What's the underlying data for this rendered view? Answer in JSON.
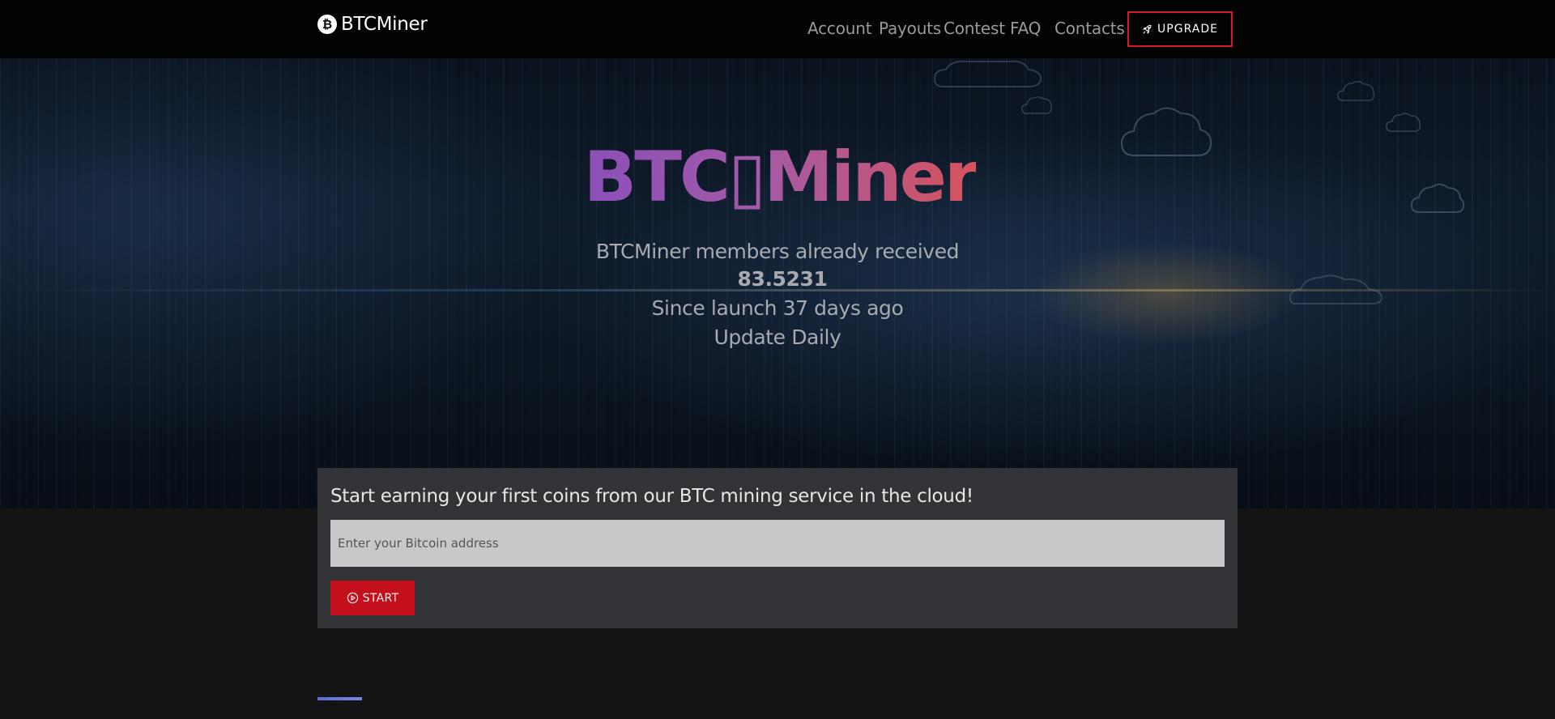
{
  "navbar": {
    "brand_icon": "bitcoin-icon",
    "brand_name": "BTCMiner",
    "links": [
      {
        "label": "Account"
      },
      {
        "label": "Payouts"
      },
      {
        "label": "Contest"
      },
      {
        "label": "FAQ"
      },
      {
        "label": "Contacts"
      }
    ],
    "upgrade": {
      "icon": "rocket-icon",
      "label": "UPGRADE",
      "border_color": "#d8192b"
    }
  },
  "hero": {
    "logo_text": "BTC▯Miner",
    "received_text": "BTCMiner members already received",
    "received_amount": "83.5231",
    "launch_text": "Since launch 37 days ago",
    "update_text": "Update Daily",
    "logo_gradient": [
      "#8b4fb8",
      "#d5535c"
    ]
  },
  "signup": {
    "heading": "Start earning your first coins from our BTC mining service in the cloud!",
    "address_placeholder": "Enter your Bitcoin address",
    "address_value": "",
    "start_icon": "play-circle-icon",
    "start_label": "START",
    "start_color": "#c3101c"
  },
  "colors": {
    "navbar_bg": "#020202",
    "page_bg": "#141414",
    "card_bg": "#323336",
    "accent_bar": "#5d6fd6"
  }
}
